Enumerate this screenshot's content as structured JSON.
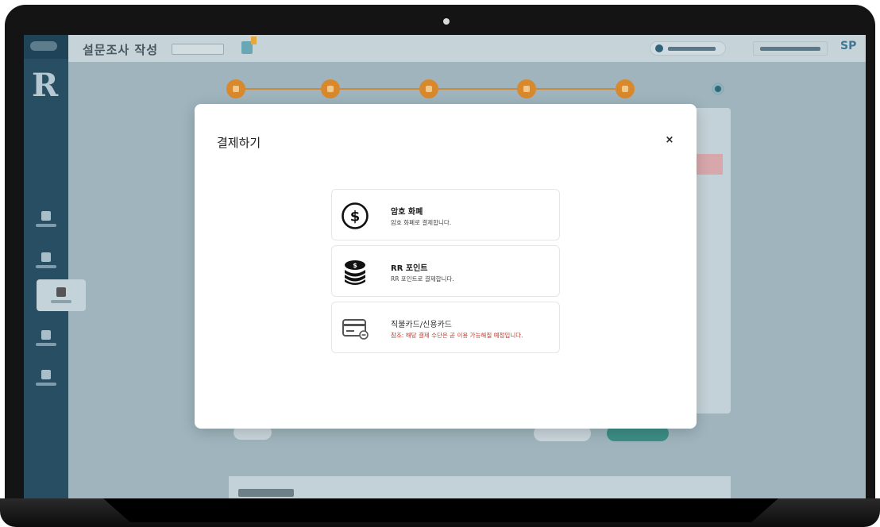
{
  "background_app": {
    "title": "설문조사 작성",
    "avatar_initials": "SP"
  },
  "modal": {
    "title": "결제하기",
    "close_label": "×",
    "options": [
      {
        "name": "암호 화폐",
        "description": "암호 화폐로 결제합니다.",
        "icon": "dollar-circle-icon",
        "available": true
      },
      {
        "name": "RR 포인트",
        "description": "RR 포인트로 결제합니다.",
        "icon": "coin-stack-icon",
        "available": true
      },
      {
        "name": "직불카드/신용카드",
        "description": "참조: 해당 결제 수단은 곧 이용 가능해질 예정입니다.",
        "icon": "credit-card-icon",
        "available": false
      }
    ]
  },
  "colors": {
    "sidebar": "#274e63",
    "stepper_accent": "#d9892c",
    "warning_text": "#c0392b"
  }
}
